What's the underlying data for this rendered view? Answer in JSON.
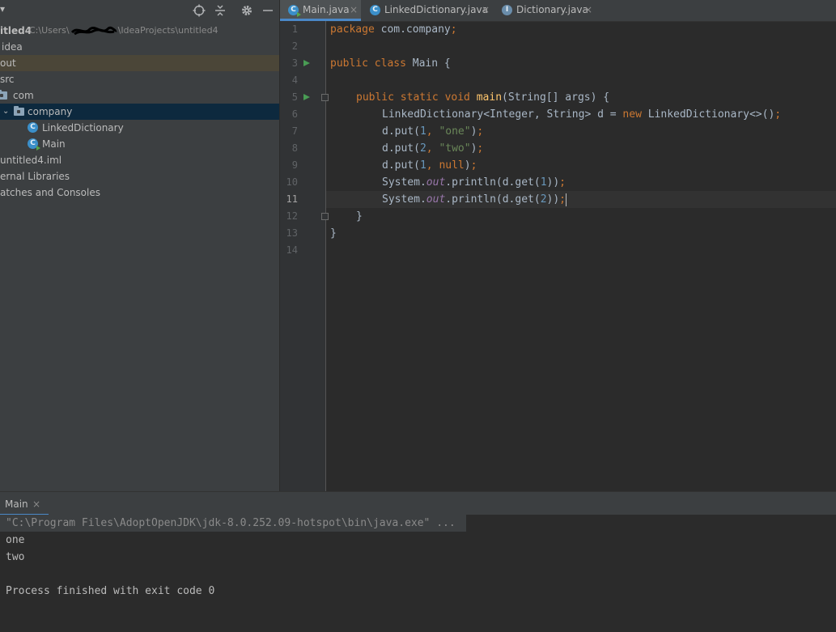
{
  "project": {
    "dropdown_label": "▾",
    "root_name": "itled4",
    "root_path_prefix": "C:\\Users\\",
    "root_path_suffix": "\\IdeaProjects\\untitled4",
    "tree": [
      {
        "label": "idea"
      },
      {
        "label": "out"
      },
      {
        "label": "src"
      },
      {
        "label": "com"
      },
      {
        "label": "company"
      },
      {
        "label": "LinkedDictionary"
      },
      {
        "label": "Main"
      },
      {
        "label": "untitled4.iml"
      },
      {
        "label": "ernal Libraries"
      },
      {
        "label": "atches and Consoles"
      }
    ]
  },
  "editor": {
    "tabs": [
      {
        "label": "Main.java"
      },
      {
        "label": "LinkedDictionary.java"
      },
      {
        "label": "Dictionary.java"
      }
    ],
    "active_tab": 0,
    "line_numbers": [
      "1",
      "2",
      "3",
      "4",
      "5",
      "6",
      "7",
      "8",
      "9",
      "10",
      "11",
      "12",
      "13",
      "14"
    ],
    "current_line": 11,
    "code": {
      "l1_kw": "package",
      "l1_rest": " com.company",
      "l1_semi": ";",
      "l3_kw": "public class",
      "l3_rest": " Main {",
      "l5_kw": "public static void",
      "l5_fn": "main",
      "l5_rest": "(String[] args) {",
      "l6_a": "LinkedDictionary<Integer, String> d = ",
      "l6_kw": "new",
      "l6_b": " LinkedDictionary<>()",
      "l6_semi": ";",
      "l7_a": "d.put(",
      "l7_num": "1",
      "l7_comma": ", ",
      "l7_str": "\"one\"",
      "l7_end": ")",
      "l7_semi": ";",
      "l8_a": "d.put(",
      "l8_num": "2",
      "l8_comma": ", ",
      "l8_str": "\"two\"",
      "l8_end": ")",
      "l8_semi": ";",
      "l9_a": "d.put(",
      "l9_num": "1",
      "l9_comma": ", ",
      "l9_kw": "null",
      "l9_end": ")",
      "l9_semi": ";",
      "l10_a": "System.",
      "l10_stat": "out",
      "l10_b": ".println(d.get(",
      "l10_num": "1",
      "l10_end": "))",
      "l10_semi": ";",
      "l11_a": "System.",
      "l11_stat": "out",
      "l11_b": ".println(d.get(",
      "l11_num": "2",
      "l11_end": "))",
      "l11_semi": ";",
      "l12": "}",
      "l13": "}"
    }
  },
  "run": {
    "tab_label": "Main",
    "tab_close": "×",
    "command": "\"C:\\Program Files\\AdoptOpenJDK\\jdk-8.0.252.09-hotspot\\bin\\java.exe\" ...",
    "output": [
      "one",
      "two",
      "",
      "Process finished with exit code 0"
    ]
  },
  "colors": {
    "accent": "#4a88c7",
    "keyword": "#cc7832",
    "string": "#6a8759",
    "number": "#6897bb",
    "function": "#ffc66d",
    "static_field": "#9876aa"
  },
  "icons": {
    "toolbar": [
      "locate-icon",
      "collapse-icon",
      "gear-icon",
      "minimize-icon"
    ],
    "tree_folder": "folder-icon",
    "tree_class": "java-class-icon"
  }
}
